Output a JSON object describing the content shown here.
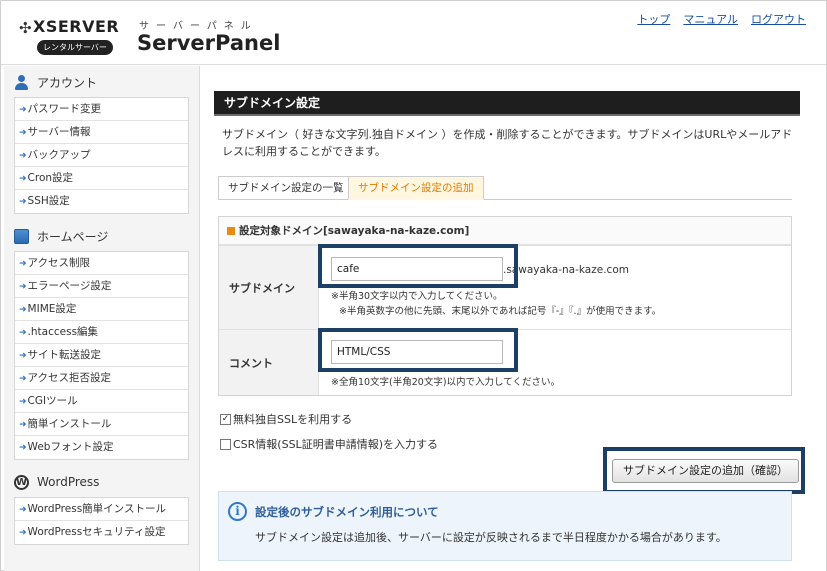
{
  "brand": {
    "logo_text": "XSERVER",
    "logo_badge": "レンタルサーバー",
    "kana": "サーバーパネル",
    "product": "ServerPanel"
  },
  "toplinks": [
    "トップ",
    "マニュアル",
    "ログアウト"
  ],
  "sidebar": {
    "account": {
      "title": "アカウント",
      "items": [
        "パスワード変更",
        "サーバー情報",
        "バックアップ",
        "Cron設定",
        "SSH設定"
      ]
    },
    "homepage": {
      "title": "ホームページ",
      "items": [
        "アクセス制限",
        "エラーページ設定",
        "MIME設定",
        ".htaccess編集",
        "サイト転送設定",
        "アクセス拒否設定",
        "CGIツール",
        "簡単インストール",
        "Webフォント設定"
      ]
    },
    "wordpress": {
      "title": "WordPress",
      "items": [
        "WordPress簡単インストール",
        "WordPressセキュリティ設定"
      ]
    }
  },
  "main": {
    "title": "サブドメイン設定",
    "description": "サブドメイン（ 好きな文字列.独自ドメイン ）を作成・削除することができます。サブドメインはURLやメールアドレスに利用することができます。",
    "tabs": [
      "サブドメイン設定の一覧",
      "サブドメイン設定の追加"
    ],
    "panel_head": "設定対象ドメイン[sawayaka-na-kaze.com]",
    "subdomain": {
      "label": "サブドメイン",
      "value": "cafe",
      "suffix": ".sawayaka-na-kaze.com",
      "note1": "※半角30文字以内で入力してください。",
      "note2": "※半角英数字の他に先頭、末尾以外であれば記号『-』『.』が使用できます。"
    },
    "comment": {
      "label": "コメント",
      "value": "HTML/CSS",
      "note": "※全角10文字(半角20文字)以内で入力してください。"
    },
    "ssl_checkbox": {
      "label": "無料独自SSLを利用する",
      "checked": true
    },
    "csr_checkbox": {
      "label": "CSR情報(SSL証明書申請情報)を入力する",
      "checked": false
    },
    "submit_button": "サブドメイン設定の追加（確認）",
    "info": {
      "title": "設定後のサブドメイン利用について",
      "text": "サブドメイン設定は追加後、サーバーに設定が反映されるまで半日程度かかる場合があります。"
    }
  },
  "colors": {
    "title_bar": "#1e1e1e",
    "highlight_box": "#1c3f66",
    "active_tab_text": "#e07a00",
    "link": "#1a4fa0"
  }
}
